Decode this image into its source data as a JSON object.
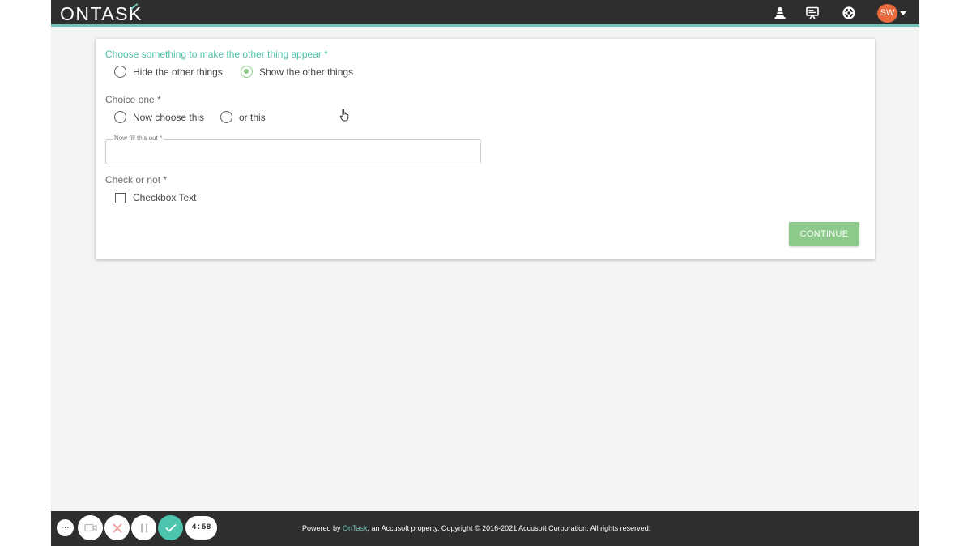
{
  "header": {
    "logo_main": "ONTAS",
    "logo_k": "K",
    "user_initials": "SW"
  },
  "form": {
    "question1": {
      "label": "Choose something to make the other thing appear *",
      "options": [
        "Hide the other things",
        "Show the other things"
      ],
      "selected": "Show the other things"
    },
    "question2": {
      "label": "Choice one *",
      "options": [
        "Now choose this",
        "or this"
      ]
    },
    "text_field": {
      "label": "Now fill this out *",
      "value": ""
    },
    "question3": {
      "label": "Check or not *",
      "checkbox_label": "Checkbox Text"
    },
    "continue_label": "CONTINUE"
  },
  "footer": {
    "prefix": "Powered by ",
    "brand": "OnTask",
    "suffix": ", an Accusoft property. Copyright © 2016-2021 Accusoft Corporation. All rights reserved."
  },
  "recorder": {
    "more_label": "···",
    "timer": "4:58"
  },
  "colors": {
    "accent": "#4dbfa8",
    "success": "#8cc98b",
    "topbar": "#2e2e2e",
    "avatar": "#e8693c"
  },
  "icons": [
    "traffic-cone-icon",
    "presentation-icon",
    "help-lifebuoy-icon",
    "camera-icon",
    "close-icon",
    "pause-icon",
    "check-icon"
  ]
}
